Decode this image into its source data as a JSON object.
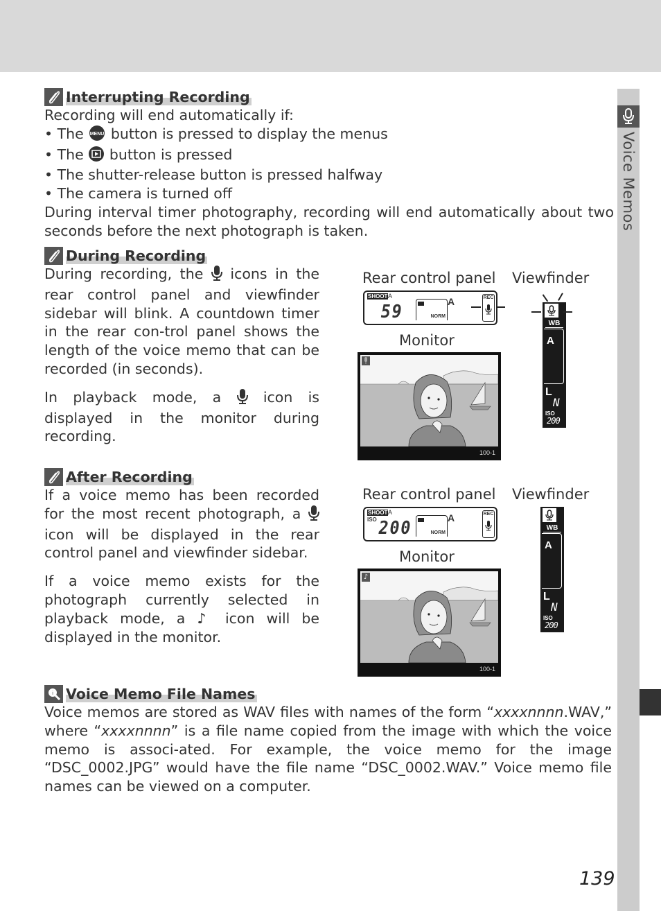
{
  "page": {
    "number": "139",
    "section_tab": "Voice Memos",
    "colors": {
      "band": "#d9d9d9",
      "tab": "#cccccc",
      "icon_bg": "#555555",
      "text": "#333333",
      "thumb": "#333333"
    }
  },
  "interrupting": {
    "title": "Interrupting Recording",
    "intro": "Recording will end automatically if:",
    "bullets": [
      {
        "pre": "• The",
        "icon": "menu-button-icon",
        "post": "button is pressed to display the menus"
      },
      {
        "pre": "• The",
        "icon": "playback-button-icon",
        "post": "button is pressed"
      },
      {
        "pre": "• The shutter-release button is pressed halfway",
        "icon": "",
        "post": ""
      },
      {
        "pre": "• The camera is turned off",
        "icon": "",
        "post": ""
      }
    ],
    "outro": "During interval timer photography, recording will end automatically about two seconds before the next photograph is taken."
  },
  "during": {
    "title": "During Recording",
    "p1_pre": "During recording, the",
    "p1_post": "icons in the rear control panel and viewfinder sidebar will blink.  A countdown timer in the rear con-trol panel shows the length of the voice memo that can be recorded (in seconds).",
    "p2_pre": "In playback mode, a",
    "p2_post": "icon is displayed in the monitor during recording.",
    "figure": {
      "rear_label": "Rear control panel",
      "viewfinder_label": "Viewfinder",
      "monitor_label": "Monitor",
      "lcd": {
        "shoot": "SHOOT",
        "shoot_bank": "A",
        "iso": "",
        "big": "59",
        "quality": "NORM",
        "wb": "A",
        "rec": "REC"
      },
      "vf": {
        "wb": "WB",
        "a": "A",
        "l": "L",
        "n": "N",
        "iso": "ISO",
        "iso_val": "200"
      },
      "monitor": {
        "frame": "100-1",
        "badge": "mic"
      }
    }
  },
  "after": {
    "title": "After Recording",
    "p1_pre": "If a voice memo has been recorded for the most recent photograph, a",
    "p1_post": "icon will be displayed in the rear control panel and viewfinder sidebar.",
    "p2_pre": "If a voice memo exists for the photograph currently selected in playback mode, a",
    "p2_icon": "♪",
    "p2_post": "icon will be displayed in the monitor.",
    "figure": {
      "rear_label": "Rear control panel",
      "viewfinder_label": "Viewfinder",
      "monitor_label": "Monitor",
      "lcd": {
        "shoot": "SHOOT",
        "shoot_bank": "A",
        "iso": "ISO",
        "big": "200",
        "quality": "NORM",
        "wb": "A",
        "rec": "REC"
      },
      "vf": {
        "wb": "WB",
        "a": "A",
        "l": "L",
        "n": "N",
        "iso": "ISO",
        "iso_val": "200"
      },
      "monitor": {
        "frame": "100-1",
        "badge": "♪"
      }
    }
  },
  "filenames": {
    "title": "Voice Memo File Names",
    "t1": "Voice memos are stored as WAV files with names of the form “",
    "t1_it": "xxxxnnnn",
    "t2": ".WAV,” where “",
    "t2_it": "xxxxnnnn",
    "t3": "” is a file name copied from the image with which the voice memo is associ-ated.  For example, the voice memo for the image “DSC_0002.JPG” would have the file name “DSC_0002.WAV.”  Voice memo file names can be viewed on a computer."
  }
}
